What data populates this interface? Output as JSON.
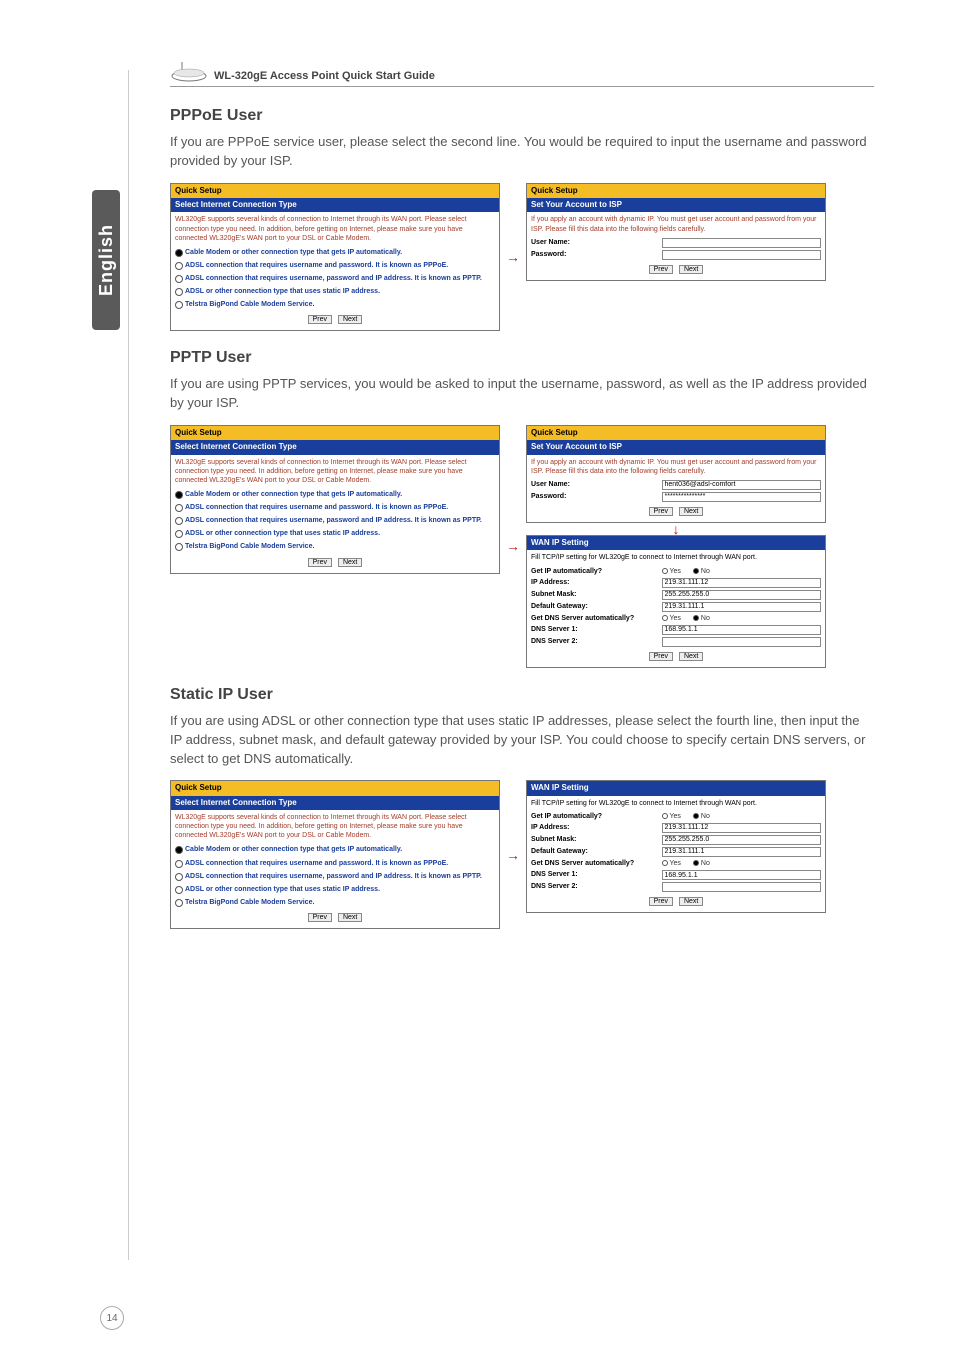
{
  "header": {
    "product_title": "WL-320gE Access Point Quick Start Guide"
  },
  "side_tab": {
    "label": "English"
  },
  "common": {
    "qs_title": "Quick Setup",
    "select_type": "Select Internet Connection Type",
    "intro_text": "WL320gE supports several kinds of connection to Internet through its WAN port. Please select connection type you need. In addition, before getting on Internet, please make sure you have connected WL320gE's WAN port to your DSL or Cable Modem.",
    "opt_cable": "Cable Modem or other connection type that gets IP automatically.",
    "opt_pppoe": "ADSL connection that requires username and password. It is known as PPPoE.",
    "opt_pptp": "ADSL connection that requires username, password and IP address. It is known as PPTP.",
    "opt_static": "ADSL or other connection type that uses static IP address.",
    "opt_telstra": "Telstra BigPond Cable Modem Service.",
    "btn_prev": "Prev",
    "btn_next": "Next",
    "isp_header": "Set Your Account to ISP",
    "isp_intro": "If you apply an account with dynamic IP. You must get user account and password from your ISP. Please fill this data into the following fields carefully.",
    "user_name_label": "User Name:",
    "password_label": "Password:",
    "wan_header": "WAN IP Setting",
    "wan_intro": "Fill TCP/IP setting for WL320gE to connect to Internet through WAN port.",
    "get_ip_auto": "Get IP automatically?",
    "ip_addr": "IP Address:",
    "subnet": "Subnet Mask:",
    "gateway": "Default Gateway:",
    "get_dns_auto": "Get DNS Server automatically?",
    "dns1": "DNS Server 1:",
    "dns2": "DNS Server 2:",
    "yes": "Yes",
    "no": "No"
  },
  "pppoe": {
    "title": "PPPoE User",
    "desc": "If you are PPPoE service user, please select the second line. You would be required to input the username and password provided by your ISP.",
    "user_value": "",
    "pass_value": ""
  },
  "pptp": {
    "title": "PPTP User",
    "desc": "If you are using PPTP services, you would be asked to input the username, password, as well as the IP address provided by your ISP.",
    "user_value": "hent036@adsl-comfort",
    "pass_value": "***************",
    "ip_value": "219.31.111.12",
    "subnet_value": "255.255.255.0",
    "gateway_value": "219.31.111.1",
    "dns1_value": "168.95.1.1",
    "dns2_value": ""
  },
  "static": {
    "title": "Static IP User",
    "desc": "If you are using ADSL or other connection type that uses static IP addresses, please select the fourth line, then input the IP address, subnet mask, and default gateway provided by your ISP. You could choose to specify certain DNS servers, or select to get DNS automatically.",
    "ip_value": "219.31.111.12",
    "subnet_value": "255.255.255.0",
    "gateway_value": "219.31.111.1",
    "dns1_value": "168.95.1.1",
    "dns2_value": ""
  },
  "page_number": "14"
}
